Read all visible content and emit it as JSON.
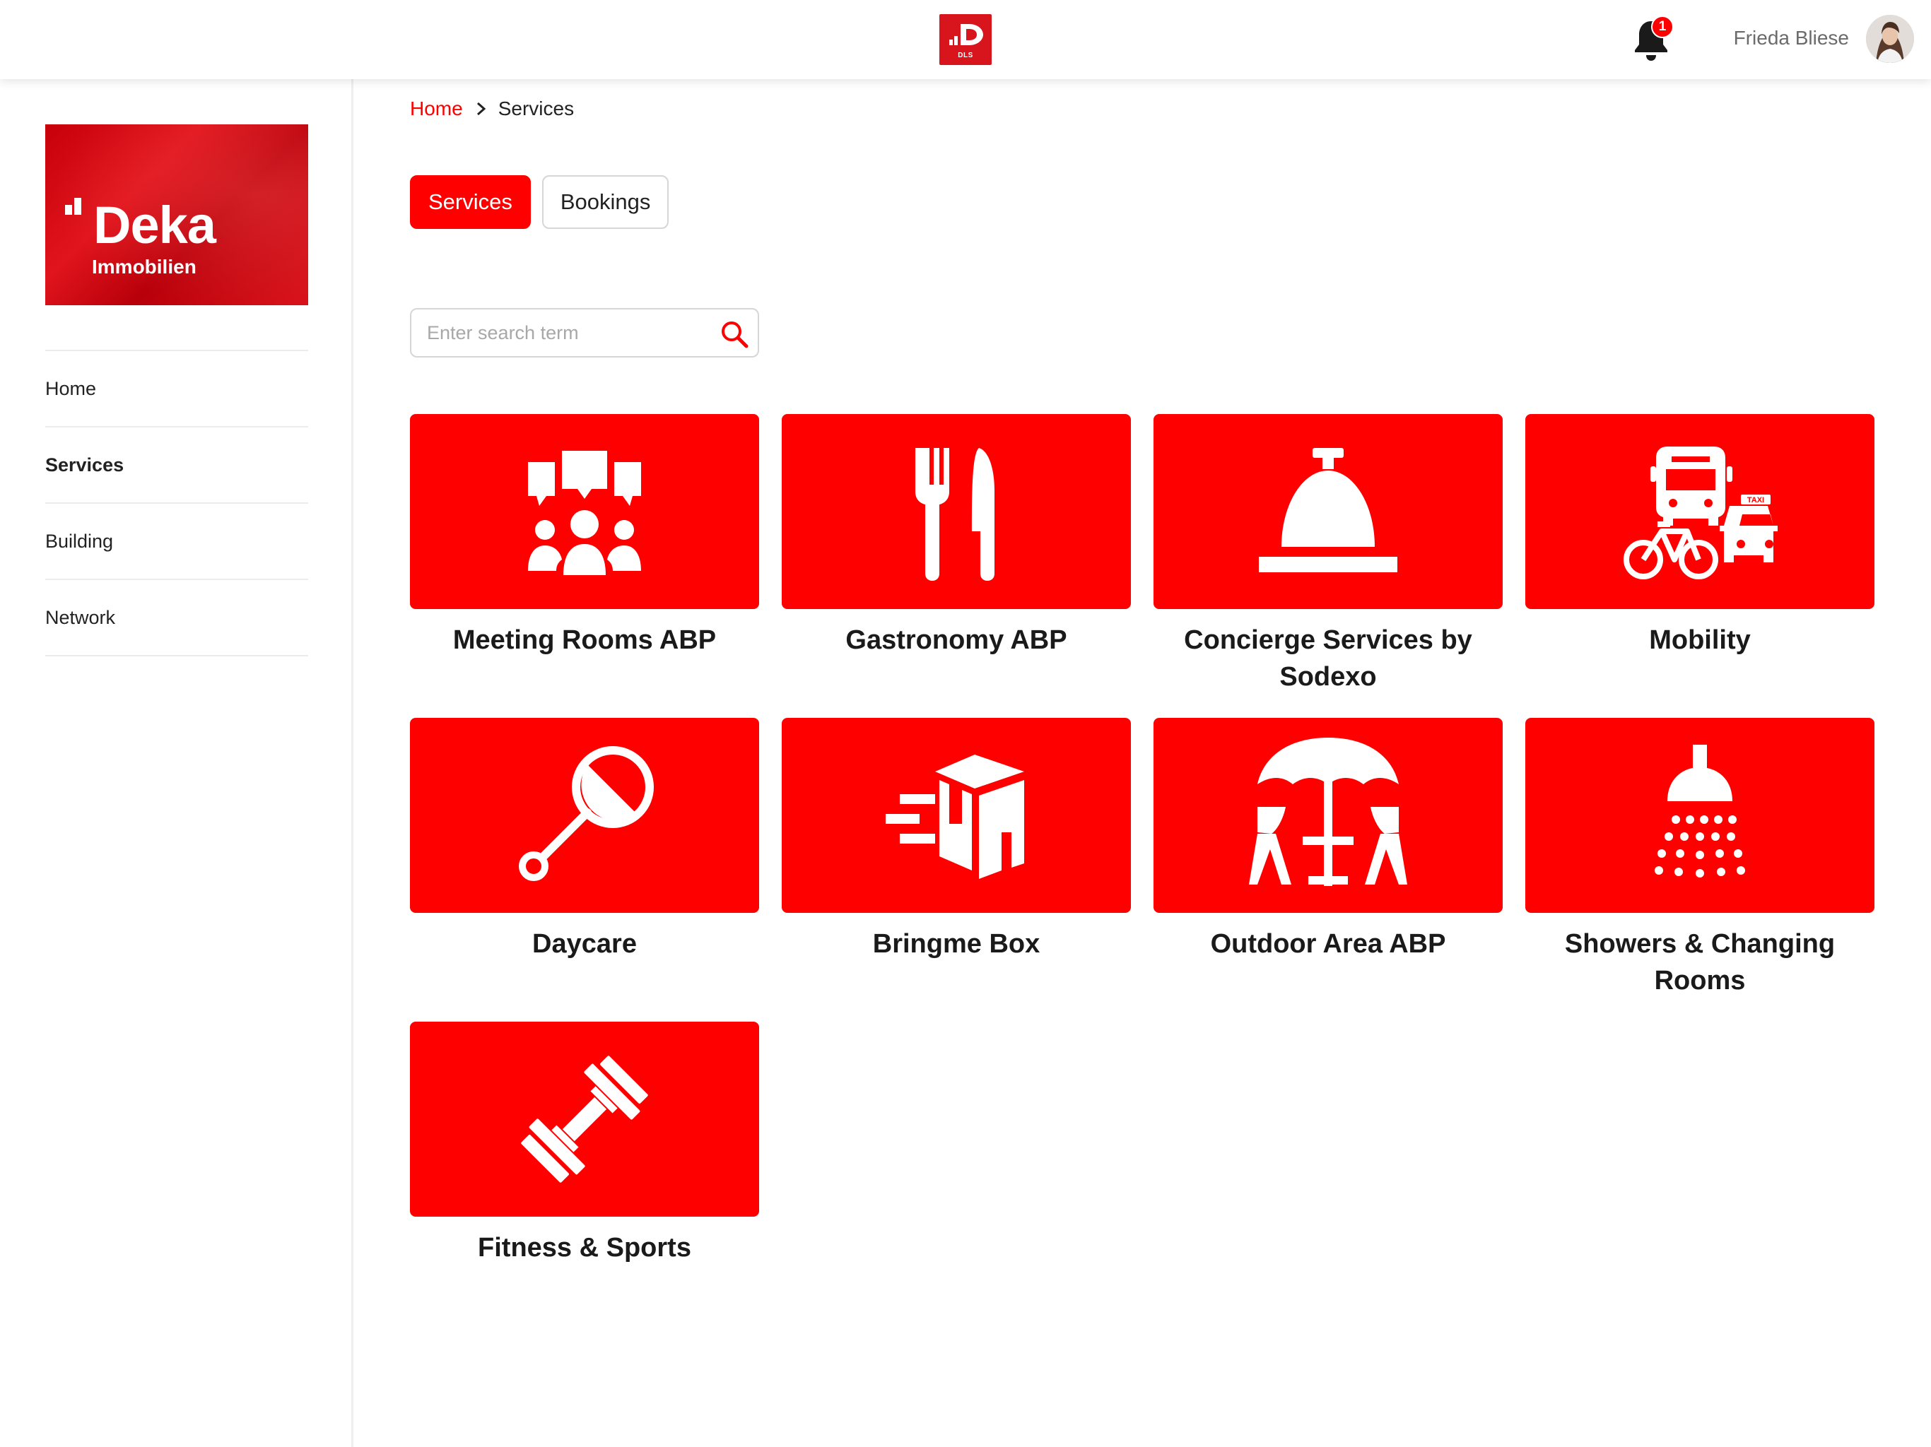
{
  "header": {
    "app_logo_text": "DLS",
    "notification_count": "1",
    "user_name": "Frieda Bliese"
  },
  "brand": {
    "name": "Deka",
    "subtitle": "Immobilien"
  },
  "sidebar": {
    "items": [
      {
        "label": "Home",
        "active": false
      },
      {
        "label": "Services",
        "active": true
      },
      {
        "label": "Building",
        "active": false
      },
      {
        "label": "Network",
        "active": false
      }
    ]
  },
  "breadcrumb": {
    "home": "Home",
    "current": "Services"
  },
  "tabs": [
    {
      "label": "Services",
      "active": true
    },
    {
      "label": "Bookings",
      "active": false
    }
  ],
  "search": {
    "placeholder": "Enter search term",
    "value": ""
  },
  "services": [
    {
      "title": "Meeting Rooms ABP",
      "icon": "meeting-icon"
    },
    {
      "title": "Gastronomy ABP",
      "icon": "fork-knife-icon"
    },
    {
      "title": "Concierge Services by Sodexo",
      "icon": "service-bell-icon"
    },
    {
      "title": "Mobility",
      "icon": "mobility-icon"
    },
    {
      "title": "Daycare",
      "icon": "rattle-icon"
    },
    {
      "title": "Bringme Box",
      "icon": "delivery-box-icon"
    },
    {
      "title": "Outdoor Area ABP",
      "icon": "patio-umbrella-icon"
    },
    {
      "title": "Showers & Changing Rooms",
      "icon": "shower-icon"
    },
    {
      "title": "Fitness & Sports",
      "icon": "dumbbell-icon"
    }
  ],
  "colors": {
    "accent": "#ff0000",
    "brand": "#d8151c",
    "text": "#222222",
    "muted": "#6b6b6b"
  },
  "taxi_sign": "TAXI"
}
